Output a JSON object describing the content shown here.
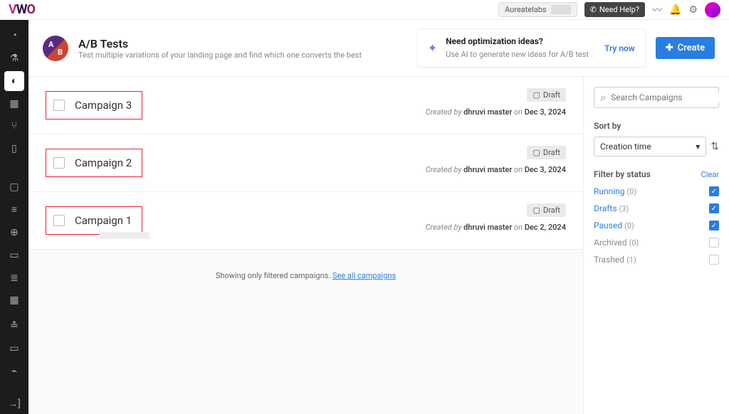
{
  "topbar": {
    "account": "Aureatelabs",
    "help": "Need Help?"
  },
  "header": {
    "title": "A/B Tests",
    "subtitle": "Test multiple variations of your landing page and find which one converts the best"
  },
  "idea": {
    "title": "Need optimization ideas?",
    "sub": "Use AI to generate new ideas for A/B test",
    "try": "Try now"
  },
  "create": "Create",
  "campaigns": [
    {
      "name": "Campaign 3",
      "status": "Draft",
      "creator": "dhruvi master",
      "date": "Dec 3, 2024"
    },
    {
      "name": "Campaign 2",
      "status": "Draft",
      "creator": "dhruvi master",
      "date": "Dec 3, 2024"
    },
    {
      "name": "Campaign 1",
      "status": "Draft",
      "creator": "dhruvi master",
      "date": "Dec 2, 2024"
    }
  ],
  "filter_msg": {
    "pre": "Showing only filtered campaigns. ",
    "link": "See all campaigns"
  },
  "search": {
    "placeholder": "Search Campaigns"
  },
  "sort": {
    "label": "Sort by",
    "value": "Creation time"
  },
  "filters": {
    "label": "Filter by status",
    "clear": "Clear",
    "items": [
      {
        "name": "Running",
        "count": "(0)",
        "checked": true
      },
      {
        "name": "Drafts",
        "count": "(3)",
        "checked": true
      },
      {
        "name": "Paused",
        "count": "(0)",
        "checked": true
      },
      {
        "name": "Archived",
        "count": "(0)",
        "checked": false
      },
      {
        "name": "Trashed",
        "count": "(1)",
        "checked": false
      }
    ]
  },
  "meta_labels": {
    "created_by": "Created by",
    "on": "on"
  }
}
